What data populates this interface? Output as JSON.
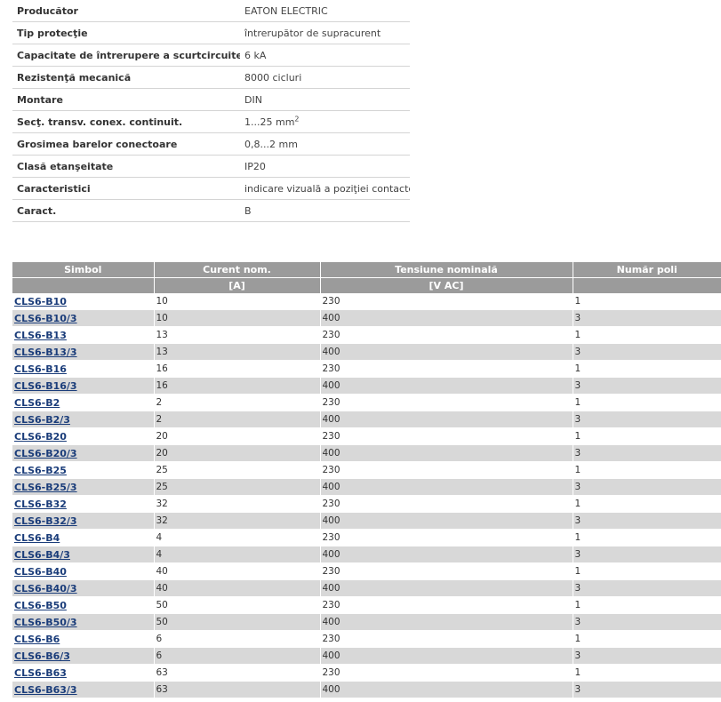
{
  "specs": [
    {
      "label": "Producător",
      "value": "EATON ELECTRIC"
    },
    {
      "label": "Tip protecţie",
      "value": "întrerupător de supracurent"
    },
    {
      "label": "Capacitate de întrerupere a scurtcircuitelor",
      "value": "6 kA"
    },
    {
      "label": "Rezistenţă mecanică",
      "value": "8000 cicluri"
    },
    {
      "label": "Montare",
      "value": "DIN"
    },
    {
      "label": "Secţ. transv. conex. continuit.",
      "value": "1...25 mm",
      "value_sup": "2"
    },
    {
      "label": "Grosimea barelor conectoare",
      "value": "0,8...2 mm"
    },
    {
      "label": "Clasă etanşeitate",
      "value": "IP20"
    },
    {
      "label": "Caracteristici",
      "value": "indicare vizuală a poziţiei contactelor"
    },
    {
      "label": "Caract.",
      "value": "B"
    }
  ],
  "products": {
    "headers": [
      "Simbol",
      "Curent nom.",
      "Tensiune nominală",
      "Număr poli"
    ],
    "units": [
      "",
      "[A]",
      "[V AC]",
      ""
    ],
    "rows": [
      {
        "symbol": "CLS6-B10",
        "current": "10",
        "voltage": "230",
        "poles": "1"
      },
      {
        "symbol": "CLS6-B10/3",
        "current": "10",
        "voltage": "400",
        "poles": "3"
      },
      {
        "symbol": "CLS6-B13",
        "current": "13",
        "voltage": "230",
        "poles": "1"
      },
      {
        "symbol": "CLS6-B13/3",
        "current": "13",
        "voltage": "400",
        "poles": "3"
      },
      {
        "symbol": "CLS6-B16",
        "current": "16",
        "voltage": "230",
        "poles": "1"
      },
      {
        "symbol": "CLS6-B16/3",
        "current": "16",
        "voltage": "400",
        "poles": "3"
      },
      {
        "symbol": "CLS6-B2",
        "current": "2",
        "voltage": "230",
        "poles": "1"
      },
      {
        "symbol": "CLS6-B2/3",
        "current": "2",
        "voltage": "400",
        "poles": "3"
      },
      {
        "symbol": "CLS6-B20",
        "current": "20",
        "voltage": "230",
        "poles": "1"
      },
      {
        "symbol": "CLS6-B20/3",
        "current": "20",
        "voltage": "400",
        "poles": "3"
      },
      {
        "symbol": "CLS6-B25",
        "current": "25",
        "voltage": "230",
        "poles": "1"
      },
      {
        "symbol": "CLS6-B25/3",
        "current": "25",
        "voltage": "400",
        "poles": "3"
      },
      {
        "symbol": "CLS6-B32",
        "current": "32",
        "voltage": "230",
        "poles": "1"
      },
      {
        "symbol": "CLS6-B32/3",
        "current": "32",
        "voltage": "400",
        "poles": "3"
      },
      {
        "symbol": "CLS6-B4",
        "current": "4",
        "voltage": "230",
        "poles": "1"
      },
      {
        "symbol": "CLS6-B4/3",
        "current": "4",
        "voltage": "400",
        "poles": "3"
      },
      {
        "symbol": "CLS6-B40",
        "current": "40",
        "voltage": "230",
        "poles": "1"
      },
      {
        "symbol": "CLS6-B40/3",
        "current": "40",
        "voltage": "400",
        "poles": "3"
      },
      {
        "symbol": "CLS6-B50",
        "current": "50",
        "voltage": "230",
        "poles": "1"
      },
      {
        "symbol": "CLS6-B50/3",
        "current": "50",
        "voltage": "400",
        "poles": "3"
      },
      {
        "symbol": "CLS6-B6",
        "current": "6",
        "voltage": "230",
        "poles": "1"
      },
      {
        "symbol": "CLS6-B6/3",
        "current": "6",
        "voltage": "400",
        "poles": "3"
      },
      {
        "symbol": "CLS6-B63",
        "current": "63",
        "voltage": "230",
        "poles": "1"
      },
      {
        "symbol": "CLS6-B63/3",
        "current": "63",
        "voltage": "400",
        "poles": "3"
      }
    ]
  }
}
